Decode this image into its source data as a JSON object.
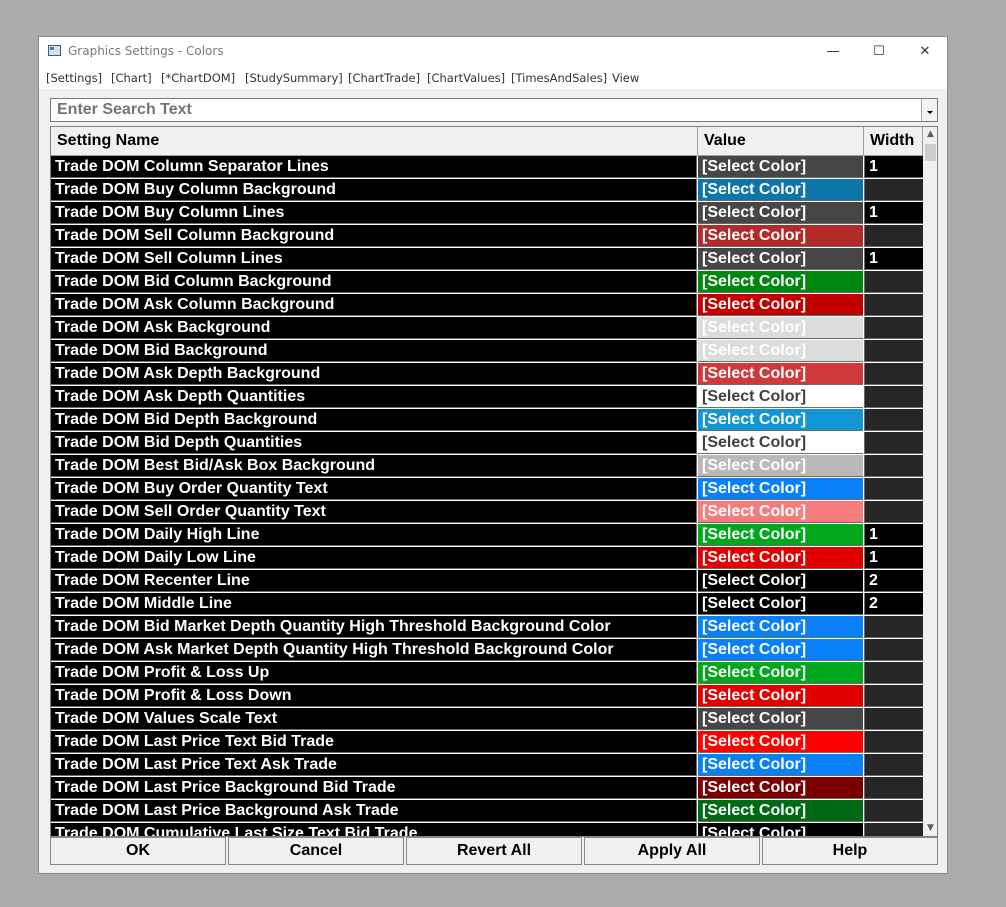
{
  "window": {
    "title": "Graphics Settings - Colors",
    "minimize": "—",
    "maximize": "☐",
    "close": "✕"
  },
  "menu": [
    "[Settings]",
    "[Chart]",
    "[*ChartDOM]",
    "[StudySummary]",
    "[ChartTrade]",
    "[ChartValues]",
    "[TimesAndSales]",
    "View"
  ],
  "search": {
    "placeholder": "Enter Search Text",
    "value": ""
  },
  "table": {
    "columns": [
      "Setting Name",
      "Value",
      "Width"
    ],
    "rows": [
      {
        "name": "Trade DOM Column Separator Lines",
        "value": "[Select Color]",
        "color": "#464646",
        "text": "#ffffff",
        "width": "1"
      },
      {
        "name": "Trade DOM Buy Column Background",
        "value": "[Select Color]",
        "color": "#0c75aa",
        "text": "#ffffff",
        "width": ""
      },
      {
        "name": "Trade DOM Buy Column Lines",
        "value": "[Select Color]",
        "color": "#464646",
        "text": "#ffffff",
        "width": "1"
      },
      {
        "name": "Trade DOM Sell Column Background",
        "value": "[Select Color]",
        "color": "#b32a2a",
        "text": "#ffffff",
        "width": ""
      },
      {
        "name": "Trade DOM Sell Column Lines",
        "value": "[Select Color]",
        "color": "#464646",
        "text": "#ffffff",
        "width": "1"
      },
      {
        "name": "Trade DOM Bid Column Background",
        "value": "[Select Color]",
        "color": "#00870e",
        "text": "#ffffff",
        "width": ""
      },
      {
        "name": "Trade DOM Ask Column Background",
        "value": "[Select Color]",
        "color": "#c20000",
        "text": "#ffffff",
        "width": ""
      },
      {
        "name": "Trade DOM Ask Background",
        "value": "[Select Color]",
        "color": "#dcdcdc",
        "text": "#ffffff",
        "width": ""
      },
      {
        "name": "Trade DOM Bid Background",
        "value": "[Select Color]",
        "color": "#dcdcdc",
        "text": "#ffffff",
        "width": ""
      },
      {
        "name": "Trade DOM Ask Depth Background",
        "value": "[Select Color]",
        "color": "#d0393a",
        "text": "#ffffff",
        "width": ""
      },
      {
        "name": "Trade DOM Ask Depth Quantities",
        "value": "[Select Color]",
        "color": "#ffffff",
        "text": "#404040",
        "width": ""
      },
      {
        "name": "Trade DOM Bid Depth Background",
        "value": "[Select Color]",
        "color": "#1496d4",
        "text": "#ffffff",
        "width": ""
      },
      {
        "name": "Trade DOM Bid Depth Quantities",
        "value": "[Select Color]",
        "color": "#ffffff",
        "text": "#404040",
        "width": ""
      },
      {
        "name": "Trade DOM Best Bid/Ask Box Background",
        "value": "[Select Color]",
        "color": "#b9b9b9",
        "text": "#ffffff",
        "width": ""
      },
      {
        "name": "Trade DOM Buy Order Quantity Text",
        "value": "[Select Color]",
        "color": "#0a80f7",
        "text": "#ffffff",
        "width": ""
      },
      {
        "name": "Trade DOM Sell Order Quantity Text",
        "value": "[Select Color]",
        "color": "#f67c7c",
        "text": "#ffffff",
        "width": ""
      },
      {
        "name": "Trade DOM Daily High Line",
        "value": "[Select Color]",
        "color": "#00a81c",
        "text": "#ffffff",
        "width": "1"
      },
      {
        "name": "Trade DOM Daily Low Line",
        "value": "[Select Color]",
        "color": "#e00000",
        "text": "#ffffff",
        "width": "1"
      },
      {
        "name": "Trade DOM Recenter Line",
        "value": "[Select Color]",
        "color": "#000000",
        "text": "#ffffff",
        "width": "2"
      },
      {
        "name": "Trade DOM Middle Line",
        "value": "[Select Color]",
        "color": "#000000",
        "text": "#ffffff",
        "width": "2"
      },
      {
        "name": "Trade DOM Bid Market Depth Quantity High Threshold Background Color",
        "value": "[Select Color]",
        "color": "#0a80f7",
        "text": "#ffffff",
        "width": ""
      },
      {
        "name": "Trade DOM Ask Market Depth Quantity High Threshold Background Color",
        "value": "[Select Color]",
        "color": "#0a80f7",
        "text": "#ffffff",
        "width": ""
      },
      {
        "name": "Trade DOM Profit & Loss Up",
        "value": "[Select Color]",
        "color": "#00a81c",
        "text": "#ffffff",
        "width": ""
      },
      {
        "name": "Trade DOM Profit & Loss Down",
        "value": "[Select Color]",
        "color": "#e00000",
        "text": "#ffffff",
        "width": ""
      },
      {
        "name": "Trade DOM Values Scale Text",
        "value": "[Select Color]",
        "color": "#464646",
        "text": "#ffffff",
        "width": ""
      },
      {
        "name": "Trade DOM Last Price Text Bid Trade",
        "value": "[Select Color]",
        "color": "#ff0000",
        "text": "#ffffff",
        "width": ""
      },
      {
        "name": "Trade DOM Last Price Text Ask Trade",
        "value": "[Select Color]",
        "color": "#0a80f7",
        "text": "#ffffff",
        "width": ""
      },
      {
        "name": "Trade DOM Last Price Background Bid Trade",
        "value": "[Select Color]",
        "color": "#7a0000",
        "text": "#ffffff",
        "width": ""
      },
      {
        "name": "Trade DOM Last Price Background Ask Trade",
        "value": "[Select Color]",
        "color": "#006b14",
        "text": "#ffffff",
        "width": ""
      },
      {
        "name": "Trade DOM Cumulative Last Size Text Bid Trade",
        "value": "[Select Color]",
        "color": "#000000",
        "text": "#ffffff",
        "width": ""
      }
    ]
  },
  "buttons": {
    "ok": "OK",
    "cancel": "Cancel",
    "revert_all": "Revert All",
    "apply_all": "Apply All",
    "help": "Help"
  }
}
